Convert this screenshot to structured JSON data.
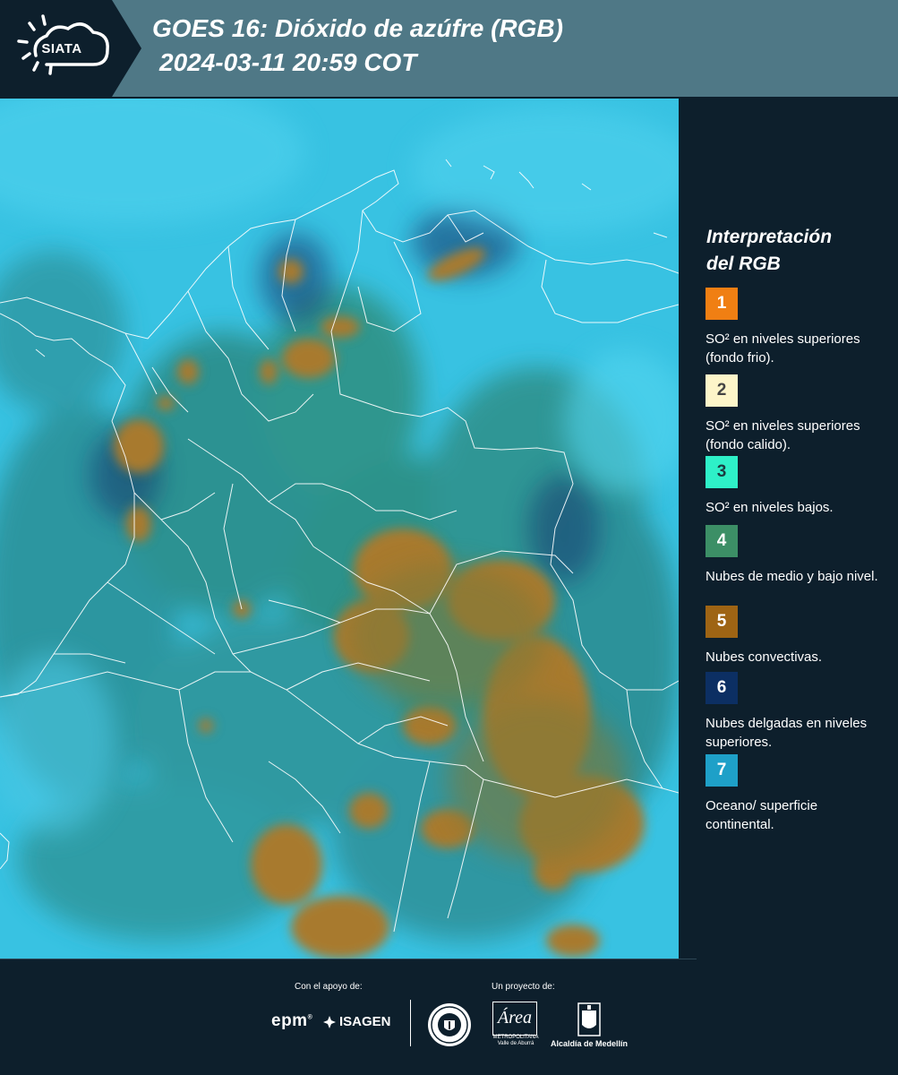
{
  "header": {
    "logo_text": "SIATA",
    "title_line1": "GOES 16: Dióxido de azúfre (RGB)",
    "title_line2": "2024-03-11 20:59 COT"
  },
  "legend": {
    "title_line1": "Interpretación",
    "title_line2": "del RGB",
    "items": [
      {
        "number": "1",
        "color": "#f07f13",
        "text_color": "#ffffff",
        "description": "SO² en niveles superiores (fondo frio)."
      },
      {
        "number": "2",
        "color": "#fdf5c9",
        "text_color": "#444444",
        "description": "SO² en niveles superiores (fondo calido)."
      },
      {
        "number": "3",
        "color": "#2ef0c8",
        "text_color": "#1c3b40",
        "description": "SO² en niveles bajos."
      },
      {
        "number": "4",
        "color": "#3c8f66",
        "text_color": "#ffffff",
        "description": "Nubes de medio y bajo nivel."
      },
      {
        "number": "5",
        "color": "#9e6414",
        "text_color": "#ffffff",
        "description": "Nubes convectivas."
      },
      {
        "number": "6",
        "color": "#0c2f63",
        "text_color": "#ffffff",
        "description": "Nubes delgadas en niveles superiores."
      },
      {
        "number": "7",
        "color": "#1ea0c8",
        "text_color": "#ffffff",
        "description": "Oceano/ superficie continental."
      }
    ]
  },
  "footer": {
    "support_label": "Con el apoyo de:",
    "project_label": "Un proyecto de:",
    "sponsors": [
      "epm",
      "ISAGEN"
    ],
    "partners": {
      "area_title": "Área",
      "area_sub1": "METROPOLITANA",
      "area_sub2": "Valle de Aburrá",
      "alcaldia": "Alcaldía de Medellín"
    }
  },
  "colors": {
    "header_bg": "#4f7886",
    "dark_bg": "#0d1f2c",
    "map_cyan": "#34bfe0",
    "map_teal": "#2a8f92",
    "convective": "#a87a2e"
  }
}
